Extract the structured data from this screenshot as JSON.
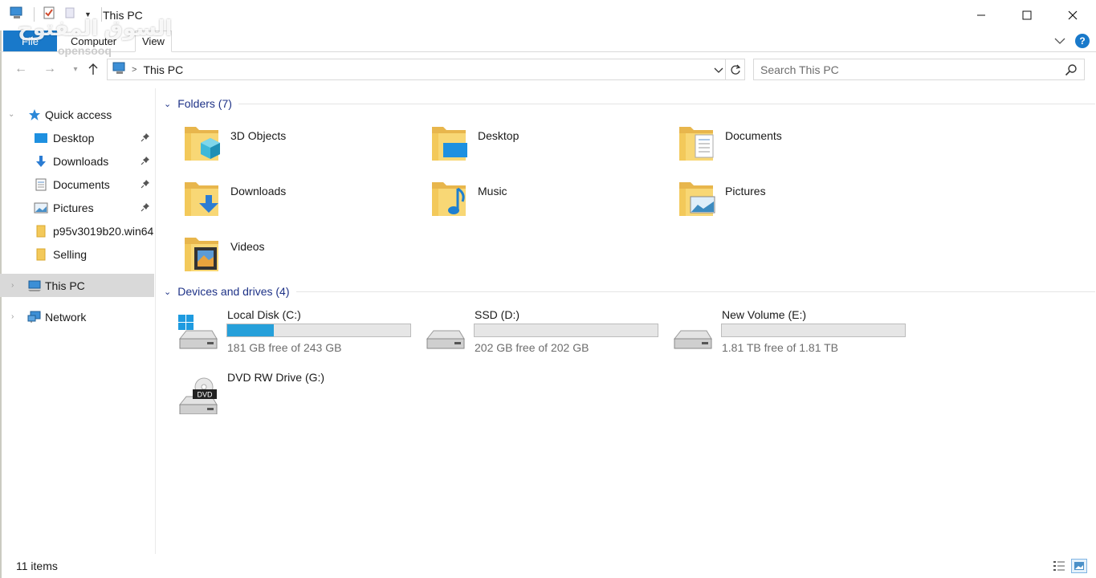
{
  "window": {
    "title": "This PC"
  },
  "ribbon": {
    "tabs": [
      "File",
      "Computer",
      "View"
    ]
  },
  "watermark": {
    "text": "السوق المفتوح",
    "sub": "opensooq"
  },
  "navigation": {
    "breadcrumb": "This PC",
    "search_placeholder": "Search This PC"
  },
  "sidebar": {
    "quick_access": "Quick access",
    "items": [
      {
        "label": "Desktop",
        "icon": "desktop-icon",
        "pinned": true
      },
      {
        "label": "Downloads",
        "icon": "downloads-icon",
        "pinned": true
      },
      {
        "label": "Documents",
        "icon": "documents-icon",
        "pinned": true
      },
      {
        "label": "Pictures",
        "icon": "pictures-icon",
        "pinned": true
      },
      {
        "label": "p95v3019b20.win64",
        "icon": "folder-icon",
        "pinned": false
      },
      {
        "label": "Selling",
        "icon": "folder-icon",
        "pinned": false
      }
    ],
    "this_pc": "This PC",
    "network": "Network"
  },
  "folders_group": {
    "title": "Folders (7)",
    "items": [
      {
        "name": "3D Objects",
        "icon": "3d-objects-folder-icon"
      },
      {
        "name": "Desktop",
        "icon": "desktop-folder-icon"
      },
      {
        "name": "Documents",
        "icon": "documents-folder-icon"
      },
      {
        "name": "Downloads",
        "icon": "downloads-folder-icon"
      },
      {
        "name": "Music",
        "icon": "music-folder-icon"
      },
      {
        "name": "Pictures",
        "icon": "pictures-folder-icon"
      },
      {
        "name": "Videos",
        "icon": "videos-folder-icon"
      }
    ]
  },
  "drives_group": {
    "title": "Devices and drives (4)",
    "items": [
      {
        "name": "Local Disk (C:)",
        "free": "181 GB free of 243 GB",
        "used_fraction": 0.255,
        "icon": "windows-drive-icon"
      },
      {
        "name": "SSD (D:)",
        "free": "202 GB free of 202 GB",
        "used_fraction": 0.0,
        "icon": "drive-icon"
      },
      {
        "name": "New Volume (E:)",
        "free": "1.81 TB free of 1.81 TB",
        "used_fraction": 0.0,
        "icon": "drive-icon"
      },
      {
        "name": "DVD RW Drive (G:)",
        "icon": "dvd-drive-icon",
        "badge": "DVD"
      }
    ]
  },
  "status": {
    "item_count": "11 items"
  },
  "colors": {
    "accent": "#1979ca",
    "group_header": "#1e3287",
    "drive_fill": "#26a0da",
    "folder_yellow": "#f8d775"
  }
}
